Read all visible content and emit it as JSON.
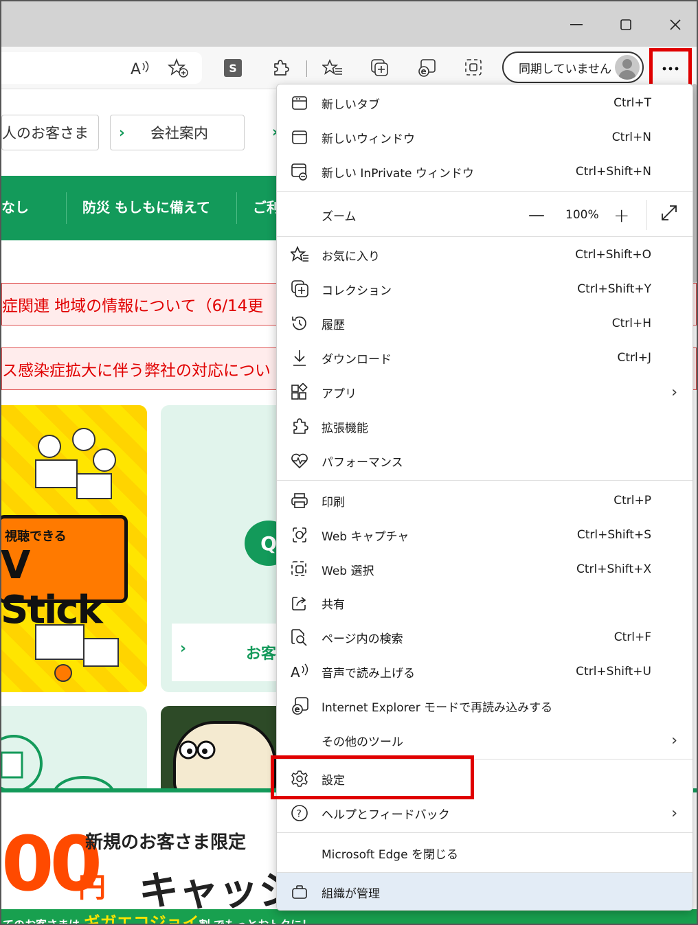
{
  "toolbar": {
    "sync_label": "同期していません",
    "s_badge": "S"
  },
  "page": {
    "pill_individual": "人のお客さま",
    "pill_company": "会社案内",
    "nav": [
      "なし",
      "防災 もしもに備えて",
      "ご利"
    ],
    "alert1": "症関連 地域の情報について（6/14更",
    "alert2": "ス感染症拡大に伴う弊社の対応につい",
    "tv_small": "視聴できる",
    "tv_big": "V Stick",
    "q_bubble": "Q",
    "mint_link": "お客",
    "banner_title": "新規のお客さま限定",
    "banner_amount": "00",
    "banner_yen": "円",
    "banner_cash": "キャッシ",
    "banner_strip_a": "てのお客さまは ",
    "banner_strip_b": "ギガエコジョイ",
    "banner_strip_c": "割 でもっとおトクに！"
  },
  "menu": {
    "items": [
      {
        "label": "新しいタブ",
        "shortcut": "Ctrl+T"
      },
      {
        "label": "新しいウィンドウ",
        "shortcut": "Ctrl+N"
      },
      {
        "label": "新しい InPrivate ウィンドウ",
        "shortcut": "Ctrl+Shift+N"
      },
      {
        "label": "ズーム",
        "shortcut": ""
      },
      {
        "label": "お気に入り",
        "shortcut": "Ctrl+Shift+O"
      },
      {
        "label": "コレクション",
        "shortcut": "Ctrl+Shift+Y"
      },
      {
        "label": "履歴",
        "shortcut": "Ctrl+H"
      },
      {
        "label": "ダウンロード",
        "shortcut": "Ctrl+J"
      },
      {
        "label": "アプリ",
        "shortcut": ""
      },
      {
        "label": "拡張機能",
        "shortcut": ""
      },
      {
        "label": "パフォーマンス",
        "shortcut": ""
      },
      {
        "label": "印刷",
        "shortcut": "Ctrl+P"
      },
      {
        "label": "Web キャプチャ",
        "shortcut": "Ctrl+Shift+S"
      },
      {
        "label": "Web 選択",
        "shortcut": "Ctrl+Shift+X"
      },
      {
        "label": "共有",
        "shortcut": ""
      },
      {
        "label": "ページ内の検索",
        "shortcut": "Ctrl+F"
      },
      {
        "label": "音声で読み上げる",
        "shortcut": "Ctrl+Shift+U"
      },
      {
        "label": "Internet Explorer モードで再読み込みする",
        "shortcut": ""
      },
      {
        "label": "その他のツール",
        "shortcut": ""
      },
      {
        "label": "設定",
        "shortcut": ""
      },
      {
        "label": "ヘルプとフィードバック",
        "shortcut": ""
      },
      {
        "label": "Microsoft Edge を閉じる",
        "shortcut": ""
      },
      {
        "label": "組織が管理",
        "shortcut": ""
      }
    ],
    "zoom_value": "100%",
    "zoom_minus": "—",
    "zoom_plus": "+"
  },
  "colors": {
    "highlight_box": "#e00000",
    "brand_green": "#139a5a",
    "managed_bg": "#e3ecf6"
  }
}
